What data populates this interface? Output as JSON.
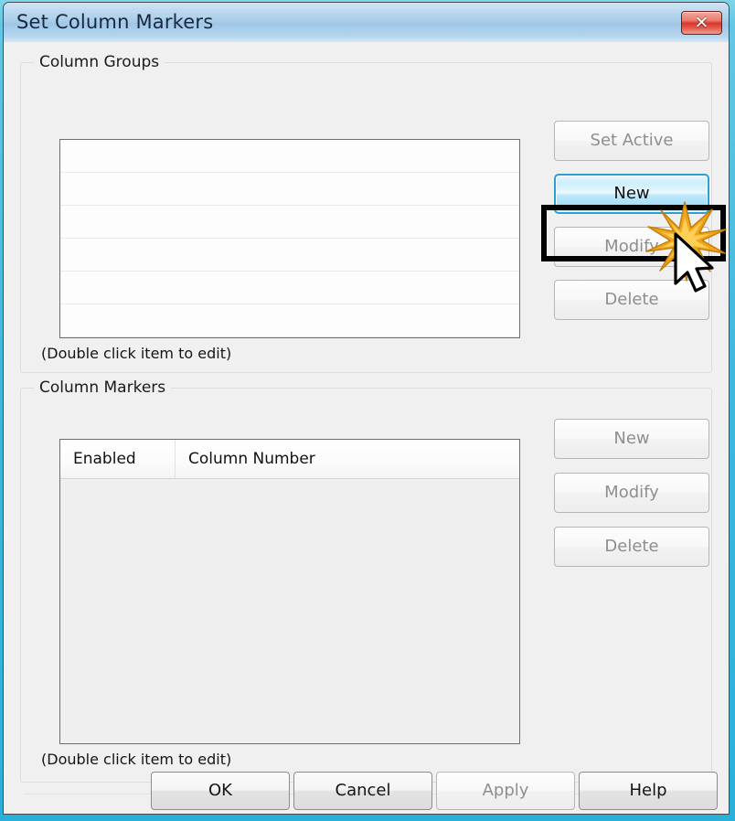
{
  "window": {
    "title": "Set Column Markers",
    "close_label": "✕",
    "close_icon": "close-icon"
  },
  "column_groups": {
    "caption": "Column Groups",
    "hint": "(Double click item to edit)",
    "items": [],
    "buttons": {
      "set_active": "Set Active",
      "new": "New",
      "modify": "Modify",
      "delete": "Delete"
    }
  },
  "column_markers": {
    "caption": "Column Markers",
    "hint": "(Double click item to edit)",
    "columns": [
      "Enabled",
      "Column Number"
    ],
    "rows": [],
    "buttons": {
      "new": "New",
      "modify": "Modify",
      "delete": "Delete"
    }
  },
  "footer": {
    "ok": "OK",
    "cancel": "Cancel",
    "apply": "Apply",
    "help": "Help"
  },
  "annotations": {
    "highlighted_control": "New",
    "cursor_icon": "mouse-pointer-icon",
    "click_burst_icon": "click-starburst-icon"
  },
  "colors": {
    "titlebar": "#a6cbe8",
    "aero_border": "#3fb8dd",
    "close_red": "#d9372a",
    "highlight_blue": "#2f9fd0",
    "annotation_black": "#000000",
    "starburst_gold": "#f0a91e",
    "dialog_bg": "#f0f0f0"
  }
}
